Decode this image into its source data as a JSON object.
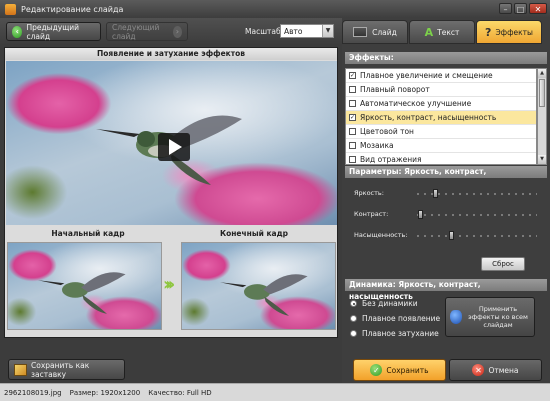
{
  "window": {
    "title": "Редактирование слайда",
    "minimize_glyph": "–",
    "maximize_glyph": "□",
    "close_glyph": "✕"
  },
  "toolbar": {
    "prev_label": "Предыдущий слайд",
    "next_label": "Следующий слайд",
    "zoom_label": "Масштаб:",
    "zoom_value": "Авто"
  },
  "preview": {
    "caption": "Появление и затухание эффектов",
    "start_frame_label": "Начальный кадр",
    "end_frame_label": "Конечный кадр",
    "play_icon": "play-icon"
  },
  "left_bottom": {
    "save_as_label": "Сохранить как заставку"
  },
  "tabs": [
    {
      "label": "Слайд",
      "icon": "slide-icon",
      "active": false
    },
    {
      "label": "Текст",
      "icon": "text-icon",
      "glyph": "A",
      "active": false
    },
    {
      "label": "Эффекты",
      "icon": "effects-icon",
      "glyph": "?",
      "active": true
    }
  ],
  "effects": {
    "heading": "Эффекты:",
    "items": [
      {
        "label": "Плавное увеличение и смещение",
        "checked": true,
        "selected": false
      },
      {
        "label": "Плавный поворот",
        "checked": false,
        "selected": false
      },
      {
        "label": "Автоматическое улучшение",
        "checked": false,
        "selected": false
      },
      {
        "label": "Яркость, контраст, насыщенность",
        "checked": true,
        "selected": true
      },
      {
        "label": "Цветовой тон",
        "checked": false,
        "selected": false
      },
      {
        "label": "Мозаика",
        "checked": false,
        "selected": false
      },
      {
        "label": "Вид отражения",
        "checked": false,
        "selected": false
      }
    ]
  },
  "params": {
    "heading": "Параметры: Яркость, контраст, насыщенность",
    "sliders": [
      {
        "label": "Яркость:",
        "value": 0.14
      },
      {
        "label": "Контраст:",
        "value": 0.01
      },
      {
        "label": "Насыщенность:",
        "value": 0.28
      }
    ],
    "reset_label": "Сброс"
  },
  "dynamics": {
    "heading": "Динамика: Яркость, контраст, насыщенность",
    "options": [
      {
        "label": "Без динамики",
        "checked": true
      },
      {
        "label": "Плавное появление",
        "checked": false
      },
      {
        "label": "Плавное затухание",
        "checked": false
      }
    ],
    "apply_label": "Применить эффекты ко всем слайдам"
  },
  "footer": {
    "save_label": "Сохранить",
    "cancel_label": "Отмена"
  },
  "status": {
    "filename": "2962108019.jpg",
    "size": "Размер: 1920x1200",
    "quality": "Качество: Full HD"
  },
  "colors": {
    "accent": "#f2a12a",
    "selection": "#fbe79e",
    "play_accent": "#8ec63f"
  }
}
